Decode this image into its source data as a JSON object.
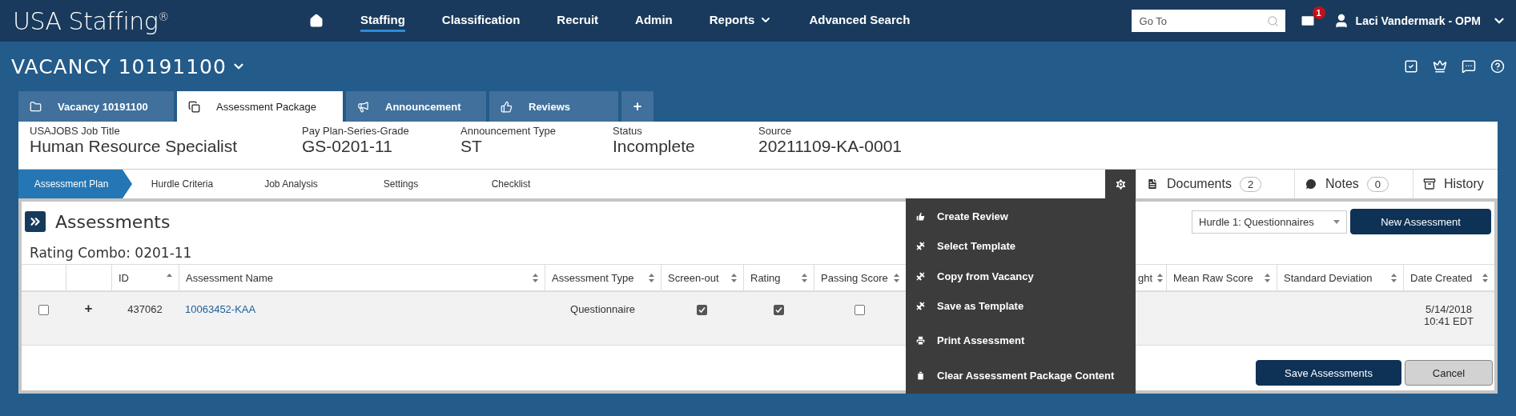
{
  "nav": {
    "logo": "USA Staffing",
    "logo_mark": "®",
    "items": [
      {
        "label": "Staffing",
        "selected": true,
        "has_menu": false
      },
      {
        "label": "Classification",
        "selected": false,
        "has_menu": false
      },
      {
        "label": "Recruit",
        "selected": false,
        "has_menu": false
      },
      {
        "label": "Admin",
        "selected": false,
        "has_menu": false
      },
      {
        "label": "Reports",
        "selected": false,
        "has_menu": true
      },
      {
        "label": "Advanced Search",
        "selected": false,
        "has_menu": false
      }
    ],
    "goto": {
      "placeholder": "Go To"
    },
    "mail_badge": "1",
    "user": "Laci Vandermark - OPM"
  },
  "vacancy_title": "VACANCY 10191100",
  "tabs": [
    {
      "label": "Vacancy 10191100",
      "selected": false
    },
    {
      "label": "Assessment Package",
      "selected": true
    },
    {
      "label": "Announcement",
      "selected": false
    },
    {
      "label": "Reviews",
      "selected": false
    }
  ],
  "add_tab": "+",
  "summary": [
    {
      "label": "USAJOBS Job Title",
      "value": "Human Resource Specialist"
    },
    {
      "label": "Pay Plan-Series-Grade",
      "value": "GS-0201-11"
    },
    {
      "label": "Announcement Type",
      "value": "ST"
    },
    {
      "label": "Status",
      "value": "Incomplete"
    },
    {
      "label": "Source",
      "value": "20211109-KA-0001"
    }
  ],
  "steps": [
    {
      "label": "Assessment Plan",
      "selected": true
    },
    {
      "label": "Hurdle Criteria",
      "selected": false
    },
    {
      "label": "Job Analysis",
      "selected": false
    },
    {
      "label": "Settings",
      "selected": false
    },
    {
      "label": "Checklist",
      "selected": false
    }
  ],
  "tools": [
    {
      "label": "Documents",
      "count": "2"
    },
    {
      "label": "Notes",
      "count": "0"
    },
    {
      "label": "History"
    }
  ],
  "panel": {
    "title": "Assessments",
    "hurdle": "Hurdle 1: Questionnaires",
    "new_button": "New Assessment",
    "rating_combo": "Rating Combo: 0201-11",
    "columns": [
      {
        "sortable": false
      },
      {
        "sortable": false
      },
      {
        "label": "ID",
        "sortable": true,
        "sorted": true
      },
      {
        "label": "Assessment Name",
        "sortable": true,
        "sorted": false
      },
      {
        "label": "Assessment Type",
        "sortable": true,
        "sorted": false
      },
      {
        "label": "Screen-out",
        "sortable": true,
        "sorted": false
      },
      {
        "label": "Rating",
        "sortable": true,
        "sorted": false
      },
      {
        "label": "Passing Score",
        "sortable": true,
        "sorted": false
      },
      {
        "label": "ght",
        "sortable": true,
        "sorted": false
      },
      {
        "label": "Mean Raw Score",
        "sortable": true,
        "sorted": false
      },
      {
        "label": "Standard Deviation",
        "sortable": true,
        "sorted": false
      },
      {
        "label": "Date Created",
        "sortable": true,
        "sorted": false
      }
    ],
    "rows": [
      {
        "selected": false,
        "expander": "+",
        "id": "437062",
        "name": "10063452-KAA",
        "type": "Questionnaire",
        "screen_out": true,
        "rating": true,
        "passing_score": false,
        "date_created": "5/14/2018 10:41 EDT"
      }
    ],
    "save_button": "Save Assessments",
    "cancel_button": "Cancel"
  },
  "menu": [
    "Create Review",
    "Select Template",
    "Copy from Vacancy",
    "Save as Template",
    "Print Assessment",
    "Clear Assessment Package Content"
  ]
}
